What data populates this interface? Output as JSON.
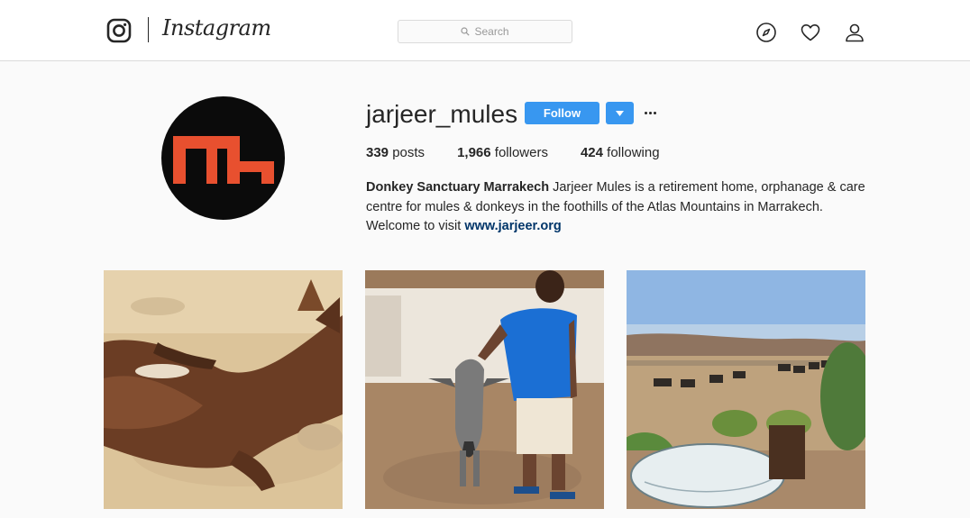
{
  "nav": {
    "brand": "Instagram",
    "search_placeholder": "Search",
    "icons": [
      "instagram-logo-icon",
      "search-icon",
      "explore-compass-icon",
      "heart-icon",
      "profile-icon"
    ]
  },
  "profile": {
    "username": "jarjeer_mules",
    "follow_label": "Follow",
    "stats": {
      "posts_count": "339",
      "posts_label": "posts",
      "followers_count": "1,966",
      "followers_label": "followers",
      "following_count": "424",
      "following_label": "following"
    },
    "bio": {
      "name": "Donkey Sanctuary Marrakech",
      "text": " Jarjeer Mules is a retirement home, orphanage & care centre for mules & donkeys in the foothills of the Atlas Mountains in Marrakech. Welcome to visit ",
      "link": "www.jarjeer.org"
    }
  },
  "colors": {
    "accent": "#3897f0",
    "link": "#003569",
    "logo_orange": "#e8502f",
    "background": "#fafafa"
  }
}
